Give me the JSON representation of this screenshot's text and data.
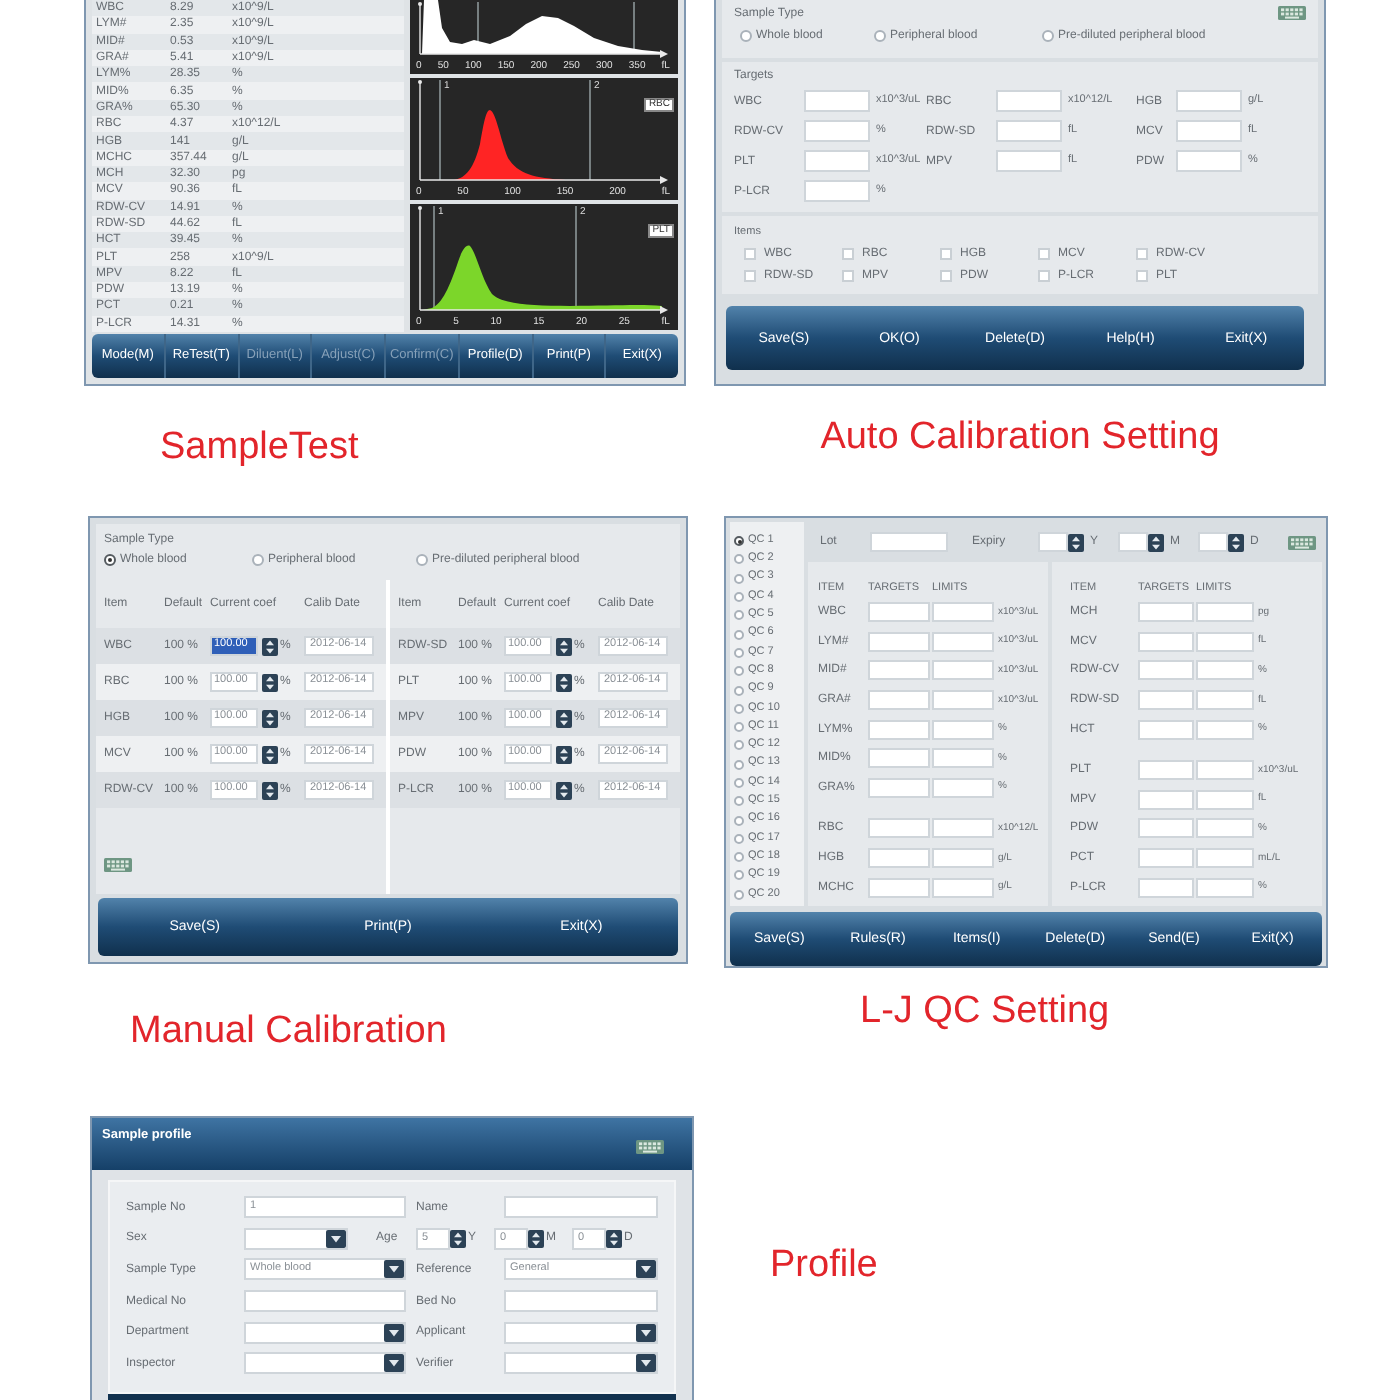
{
  "sample_test": {
    "results": [
      {
        "name": "WBC",
        "value": "8.29",
        "unit": "x10^9/L"
      },
      {
        "name": "LYM#",
        "value": "2.35",
        "unit": "x10^9/L"
      },
      {
        "name": "MID#",
        "value": "0.53",
        "unit": "x10^9/L"
      },
      {
        "name": "GRA#",
        "value": "5.41",
        "unit": "x10^9/L"
      },
      {
        "name": "LYM%",
        "value": "28.35",
        "unit": "%"
      },
      {
        "name": "MID%",
        "value": "6.35",
        "unit": "%"
      },
      {
        "name": "GRA%",
        "value": "65.30",
        "unit": "%"
      },
      {
        "name": "RBC",
        "value": "4.37",
        "unit": "x10^12/L"
      },
      {
        "name": "HGB",
        "value": "141",
        "unit": "g/L"
      },
      {
        "name": "MCHC",
        "value": "357.44",
        "unit": "g/L"
      },
      {
        "name": "MCH",
        "value": "32.30",
        "unit": "pg"
      },
      {
        "name": "MCV",
        "value": "90.36",
        "unit": "fL"
      },
      {
        "name": "RDW-CV",
        "value": "14.91",
        "unit": "%"
      },
      {
        "name": "RDW-SD",
        "value": "44.62",
        "unit": "fL"
      },
      {
        "name": "HCT",
        "value": "39.45",
        "unit": "%"
      },
      {
        "name": "PLT",
        "value": "258",
        "unit": "x10^9/L"
      },
      {
        "name": "MPV",
        "value": "8.22",
        "unit": "fL"
      },
      {
        "name": "PDW",
        "value": "13.19",
        "unit": "%"
      },
      {
        "name": "PCT",
        "value": "0.21",
        "unit": "%"
      },
      {
        "name": "P-LCR",
        "value": "14.31",
        "unit": "%"
      }
    ],
    "histograms": [
      {
        "kind": "multimodal",
        "color": "#ffffff",
        "ticks": [
          "0",
          "50",
          "100",
          "150",
          "200",
          "250",
          "300",
          "350",
          "fL"
        ]
      },
      {
        "kind": "bell",
        "color": "#ff2424",
        "tag": "RBC",
        "markers": [
          "1",
          "2"
        ],
        "ticks": [
          "0",
          "50",
          "100",
          "150",
          "200",
          "fL"
        ]
      },
      {
        "kind": "skewed",
        "color": "#7cd62a",
        "tag": "PLT",
        "markers": [
          "1",
          "2"
        ],
        "ticks": [
          "0",
          "5",
          "10",
          "15",
          "20",
          "25",
          "fL"
        ]
      }
    ],
    "buttons": [
      {
        "label": "Mode(M)",
        "disabled": false
      },
      {
        "label": "ReTest(T)",
        "disabled": false
      },
      {
        "label": "Diluent(L)",
        "disabled": true
      },
      {
        "label": "Adjust(C)",
        "disabled": true
      },
      {
        "label": "Confirm(C)",
        "disabled": true
      },
      {
        "label": "Profile(D)",
        "disabled": false
      },
      {
        "label": "Print(P)",
        "disabled": false
      },
      {
        "label": "Exit(X)",
        "disabled": false
      }
    ],
    "caption": "SampleTest"
  },
  "auto_calibration": {
    "sample_type_label": "Sample Type",
    "sample_types": [
      {
        "label": "Whole blood",
        "selected": false
      },
      {
        "label": "Peripheral blood",
        "selected": false
      },
      {
        "label": "Pre-diluted peripheral blood",
        "selected": false
      }
    ],
    "targets_label": "Targets",
    "targets": [
      {
        "name": "WBC",
        "unit": "x10^3/uL"
      },
      {
        "name": "RBC",
        "unit": "x10^12/L"
      },
      {
        "name": "HGB",
        "unit": "g/L"
      },
      {
        "name": "RDW-CV",
        "unit": "%"
      },
      {
        "name": "RDW-SD",
        "unit": "fL"
      },
      {
        "name": "MCV",
        "unit": "fL"
      },
      {
        "name": "PLT",
        "unit": "x10^3/uL"
      },
      {
        "name": "MPV",
        "unit": "fL"
      },
      {
        "name": "PDW",
        "unit": "%"
      },
      {
        "name": "P-LCR",
        "unit": "%"
      }
    ],
    "items_label": "Items",
    "items": [
      {
        "label": "WBC",
        "checked": false
      },
      {
        "label": "RBC",
        "checked": false
      },
      {
        "label": "HGB",
        "checked": false
      },
      {
        "label": "MCV",
        "checked": false
      },
      {
        "label": "RDW-CV",
        "checked": false
      },
      {
        "label": "RDW-SD",
        "checked": false
      },
      {
        "label": "MPV",
        "checked": false
      },
      {
        "label": "PDW",
        "checked": false
      },
      {
        "label": "P-LCR",
        "checked": false
      },
      {
        "label": "PLT",
        "checked": false
      }
    ],
    "buttons": [
      {
        "label": "Save(S)"
      },
      {
        "label": "OK(O)"
      },
      {
        "label": "Delete(D)"
      },
      {
        "label": "Help(H)"
      },
      {
        "label": "Exit(X)"
      }
    ],
    "caption": "Auto Calibration Setting"
  },
  "manual_calibration": {
    "sample_type_label": "Sample Type",
    "sample_types": [
      {
        "label": "Whole blood",
        "selected": true
      },
      {
        "label": "Peripheral blood",
        "selected": false
      },
      {
        "label": "Pre-diluted peripheral blood",
        "selected": false
      }
    ],
    "tables": [
      {
        "columns": [
          "Item",
          "Default",
          "Current coef",
          "Calib Date"
        ],
        "rows": [
          {
            "item": "WBC",
            "default": "100 %",
            "coef": "100.00",
            "unit": "%",
            "date": "2012-06-14",
            "focused": true
          },
          {
            "item": "RBC",
            "default": "100 %",
            "coef": "100.00",
            "unit": "%",
            "date": "2012-06-14",
            "focused": false
          },
          {
            "item": "HGB",
            "default": "100 %",
            "coef": "100.00",
            "unit": "%",
            "date": "2012-06-14",
            "focused": false
          },
          {
            "item": "MCV",
            "default": "100 %",
            "coef": "100.00",
            "unit": "%",
            "date": "2012-06-14",
            "focused": false
          },
          {
            "item": "RDW-CV",
            "default": "100 %",
            "coef": "100.00",
            "unit": "%",
            "date": "2012-06-14",
            "focused": false
          }
        ]
      },
      {
        "columns": [
          "Item",
          "Default",
          "Current coef",
          "Calib Date"
        ],
        "rows": [
          {
            "item": "RDW-SD",
            "default": "100 %",
            "coef": "100.00",
            "unit": "%",
            "date": "2012-06-14",
            "focused": false
          },
          {
            "item": "PLT",
            "default": "100 %",
            "coef": "100.00",
            "unit": "%",
            "date": "2012-06-14",
            "focused": false
          },
          {
            "item": "MPV",
            "default": "100 %",
            "coef": "100.00",
            "unit": "%",
            "date": "2012-06-14",
            "focused": false
          },
          {
            "item": "PDW",
            "default": "100 %",
            "coef": "100.00",
            "unit": "%",
            "date": "2012-06-14",
            "focused": false
          },
          {
            "item": "P-LCR",
            "default": "100 %",
            "coef": "100.00",
            "unit": "%",
            "date": "2012-06-14",
            "focused": false
          }
        ]
      }
    ],
    "buttons": [
      {
        "label": "Save(S)"
      },
      {
        "label": "Print(P)"
      },
      {
        "label": "Exit(X)"
      }
    ],
    "caption": "Manual Calibration"
  },
  "lj_qc": {
    "qc_list": [
      {
        "label": "QC 1",
        "selected": true
      },
      {
        "label": "QC 2",
        "selected": false
      },
      {
        "label": "QC 3",
        "selected": false
      },
      {
        "label": "QC 4",
        "selected": false
      },
      {
        "label": "QC 5",
        "selected": false
      },
      {
        "label": "QC 6",
        "selected": false
      },
      {
        "label": "QC 7",
        "selected": false
      },
      {
        "label": "QC 8",
        "selected": false
      },
      {
        "label": "QC 9",
        "selected": false
      },
      {
        "label": "QC 10",
        "selected": false
      },
      {
        "label": "QC 11",
        "selected": false
      },
      {
        "label": "QC 12",
        "selected": false
      },
      {
        "label": "QC 13",
        "selected": false
      },
      {
        "label": "QC 14",
        "selected": false
      },
      {
        "label": "QC 15",
        "selected": false
      },
      {
        "label": "QC 16",
        "selected": false
      },
      {
        "label": "QC 17",
        "selected": false
      },
      {
        "label": "QC 18",
        "selected": false
      },
      {
        "label": "QC 19",
        "selected": false
      },
      {
        "label": "QC 20",
        "selected": false
      }
    ],
    "lot_label": "Lot",
    "expiry_label": "Expiry",
    "expiry_units": [
      "Y",
      "M",
      "D"
    ],
    "tables": [
      {
        "columns": [
          "ITEM",
          "TARGETS",
          "LIMITS"
        ],
        "groups": [
          [
            {
              "item": "WBC",
              "unit": "x10^3/uL"
            },
            {
              "item": "LYM#",
              "unit": "x10^3/uL"
            },
            {
              "item": "MID#",
              "unit": "x10^3/uL"
            },
            {
              "item": "GRA#",
              "unit": "x10^3/uL"
            },
            {
              "item": "LYM%",
              "unit": "%"
            },
            {
              "item": "MID%",
              "unit": "%"
            },
            {
              "item": "GRA%",
              "unit": "%"
            }
          ],
          [
            {
              "item": "RBC",
              "unit": "x10^12/L"
            },
            {
              "item": "HGB",
              "unit": "g/L"
            },
            {
              "item": "MCHC",
              "unit": "g/L"
            }
          ]
        ]
      },
      {
        "columns": [
          "ITEM",
          "TARGETS",
          "LIMITS"
        ],
        "groups": [
          [
            {
              "item": "MCH",
              "unit": "pg"
            },
            {
              "item": "MCV",
              "unit": "fL"
            },
            {
              "item": "RDW-CV",
              "unit": "%"
            },
            {
              "item": "RDW-SD",
              "unit": "fL"
            },
            {
              "item": "HCT",
              "unit": "%"
            }
          ],
          [
            {
              "item": "PLT",
              "unit": "x10^3/uL"
            },
            {
              "item": "MPV",
              "unit": "fL"
            },
            {
              "item": "PDW",
              "unit": "%"
            },
            {
              "item": "PCT",
              "unit": "mL/L"
            },
            {
              "item": "P-LCR",
              "unit": "%"
            }
          ]
        ]
      }
    ],
    "buttons": [
      {
        "label": "Save(S)"
      },
      {
        "label": "Rules(R)"
      },
      {
        "label": "Items(I)"
      },
      {
        "label": "Delete(D)"
      },
      {
        "label": "Send(E)"
      },
      {
        "label": "Exit(X)"
      }
    ],
    "caption": "L-J QC Setting"
  },
  "profile": {
    "title": "Sample profile",
    "rows": [
      [
        {
          "kind": "text",
          "label": "Sample No",
          "value": "1"
        },
        {
          "kind": "text",
          "label": "Name"
        }
      ],
      [
        {
          "kind": "select",
          "label": "Sex"
        },
        {
          "kind": "age",
          "label": "Age",
          "parts": [
            {
              "value": "5",
              "unit": "Y"
            },
            {
              "value": "0",
              "unit": "M"
            },
            {
              "value": "0",
              "unit": "D"
            }
          ]
        }
      ],
      [
        {
          "kind": "select",
          "label": "Sample Type",
          "value": "Whole blood"
        },
        {
          "kind": "select",
          "label": "Reference",
          "value": "General"
        }
      ],
      [
        {
          "kind": "text",
          "label": "Medical No"
        },
        {
          "kind": "text",
          "label": "Bed No"
        }
      ],
      [
        {
          "kind": "select",
          "label": "Department"
        },
        {
          "kind": "select",
          "label": "Applicant"
        }
      ],
      [
        {
          "kind": "select",
          "label": "Inspector"
        },
        {
          "kind": "select",
          "label": "Verifier"
        }
      ]
    ],
    "caption": "Profile"
  }
}
